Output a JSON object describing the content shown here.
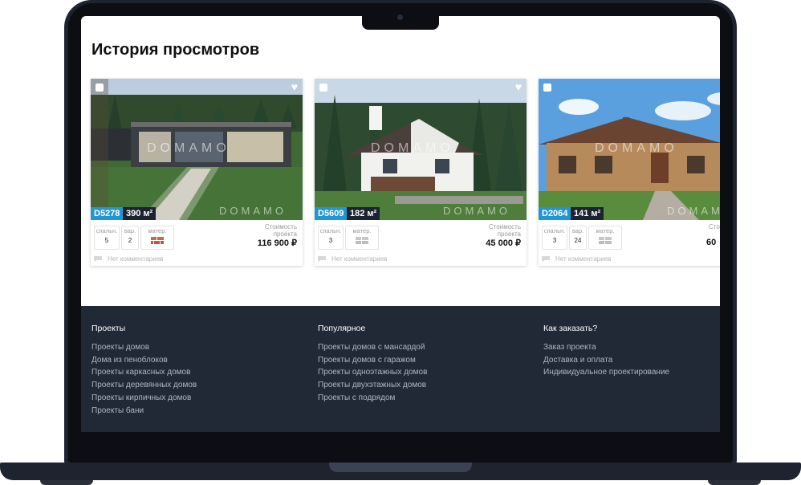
{
  "page": {
    "title": "История просмотров"
  },
  "watermark": "DOMAMO",
  "cards": [
    {
      "code": "D5278",
      "area": "390 м²",
      "specs": [
        {
          "label": "спальн.",
          "value": "5"
        },
        {
          "label": "вар.",
          "value": "2"
        },
        {
          "label": "матер.",
          "value": "",
          "icon": "brick-icon"
        }
      ],
      "cost_label": "Стоимость проекта",
      "price": "116 900 ₽",
      "comments": "Нет комментариев"
    },
    {
      "code": "D5609",
      "area": "182 м²",
      "specs": [
        {
          "label": "спальн.",
          "value": "3"
        },
        {
          "label": "матер.",
          "value": "",
          "icon": "block-icon"
        }
      ],
      "cost_label": "Стоимость проекта",
      "price": "45 000 ₽",
      "comments": "Нет комментариев"
    },
    {
      "code": "D2064",
      "area": "141 м²",
      "specs": [
        {
          "label": "спальн.",
          "value": "3"
        },
        {
          "label": "вар.",
          "value": "24"
        },
        {
          "label": "матер.",
          "value": "",
          "icon": "block-icon"
        }
      ],
      "cost_label": "Сто",
      "price": "60",
      "comments": "Нет комментариев"
    }
  ],
  "footer": {
    "columns": [
      {
        "heading": "Проекты",
        "links": [
          "Проекты домов",
          "Дома из пеноблоков",
          "Проекты каркасных домов",
          "Проекты деревянных домов",
          "Проекты кирпичных домов",
          "Проекты бани"
        ]
      },
      {
        "heading": "Популярное",
        "links": [
          "Проекты домов с мансардой",
          "Проекты домов с гаражом",
          "Проекты одноэтажных домов",
          "Проекты двухэтажных домов",
          "Проекты с подрядом"
        ]
      },
      {
        "heading": "Как заказать?",
        "links": [
          "Заказ проекта",
          "Доставка и оплата",
          "Индивидуальное проектирование"
        ]
      }
    ]
  },
  "colors": {
    "code_badge": "#2196d3",
    "area_badge": "#1b2230",
    "footer_bg": "#222936",
    "laptop_body": "#1e2330"
  }
}
